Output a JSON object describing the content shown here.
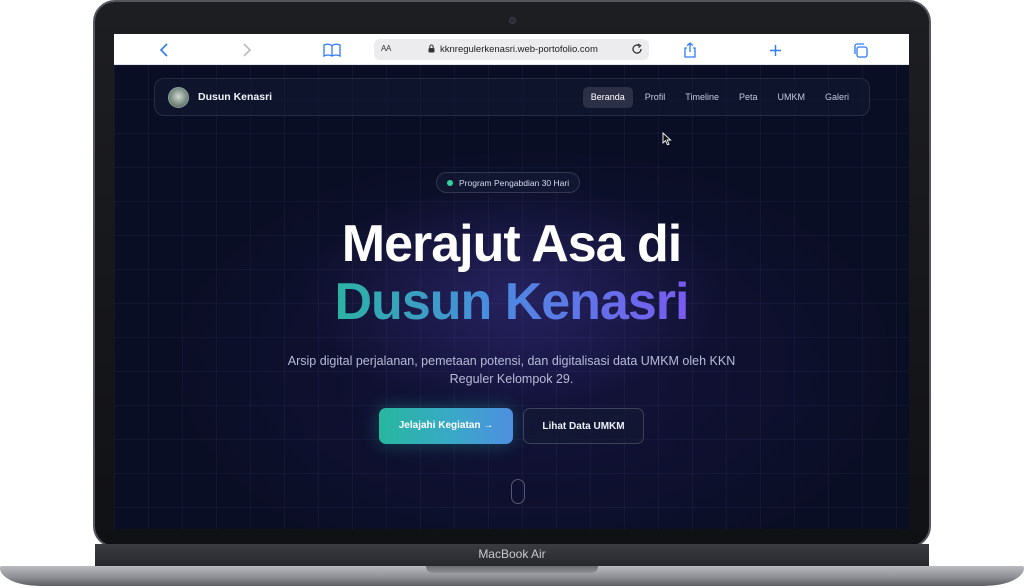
{
  "browser": {
    "text_size_label": "AA",
    "url": "kknregulerkenasri.web-portofolio.com"
  },
  "site": {
    "brand_name": "Dusun Kenasri",
    "nav": [
      {
        "label": "Beranda",
        "active": true
      },
      {
        "label": "Profil",
        "active": false
      },
      {
        "label": "Timeline",
        "active": false
      },
      {
        "label": "Peta",
        "active": false
      },
      {
        "label": "UMKM",
        "active": false
      },
      {
        "label": "Galeri",
        "active": false
      }
    ],
    "badge": "Program Pengabdian 30 Hari",
    "title_line1": "Merajut Asa di",
    "title_line2": "Dusun Kenasri",
    "subtitle": "Arsip digital perjalanan, pemetaan potensi, dan digitalisasi data UMKM oleh KKN Reguler Kelompok 29.",
    "primary_button": "Jelajahi Kegiatan →",
    "secondary_button": "Lihat Data UMKM"
  },
  "device": {
    "model": "MacBook Air"
  },
  "colors": {
    "accent_teal": "#27b79f",
    "accent_purple": "#7a5af0",
    "background": "#0a0e24"
  }
}
